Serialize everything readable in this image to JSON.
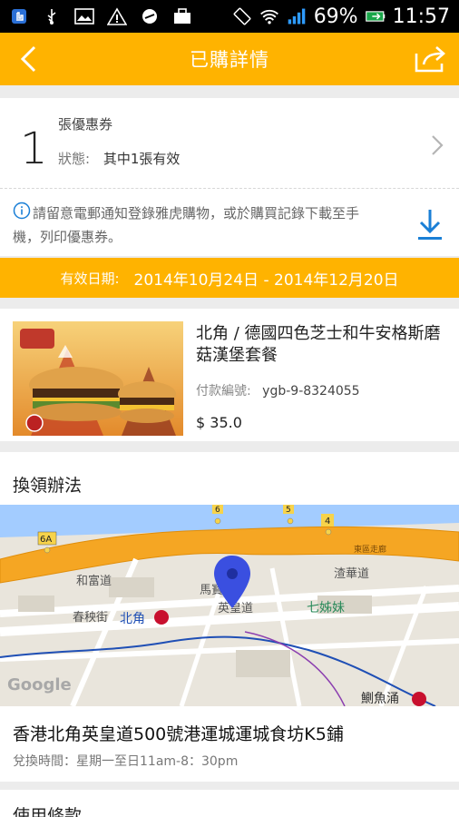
{
  "status_bar": {
    "battery_percent": "69%",
    "time": "11:57"
  },
  "appbar": {
    "title": "已購詳情"
  },
  "coupon": {
    "count": "1",
    "label": "張優惠券",
    "status_key": "狀態:",
    "status_value": "其中1張有效"
  },
  "notice": {
    "text": "請留意電郵通知登錄雅虎購物，或於購買記錄下載至手機，列印優惠券。"
  },
  "validity": {
    "label": "有效日期:",
    "range": "2014年10月24日 - 2014年12月20日"
  },
  "product": {
    "name": "北角 / 德國四色芝士和牛安格斯磨菇漢堡套餐",
    "payment_key": "付款編號:",
    "payment_value": "ygb-9-8324055",
    "price": "$ 35.0"
  },
  "redeem": {
    "title": "換領辦法",
    "address": "香港北角英皇道500號港運城運城食坊K5鋪",
    "hours": "兌換時間：星期一至日11am-8：30pm"
  },
  "map": {
    "labels": {
      "road_hohfung": "和富道",
      "road_chunyeung": "春秧街",
      "road_mawan": "馬寶",
      "road_kingsroad": "英皇道",
      "road_tsunwah": "渣華道",
      "district_northpoint": "北角",
      "district_sevensisters": "七姊妹",
      "district_quarrybay": "鰂魚涌",
      "highway": "東區走廊",
      "exit_6a": "6A",
      "exit_6": "6",
      "exit_5": "5",
      "exit_4": "4",
      "google": "Google"
    }
  },
  "terms": {
    "title": "使用條款"
  }
}
